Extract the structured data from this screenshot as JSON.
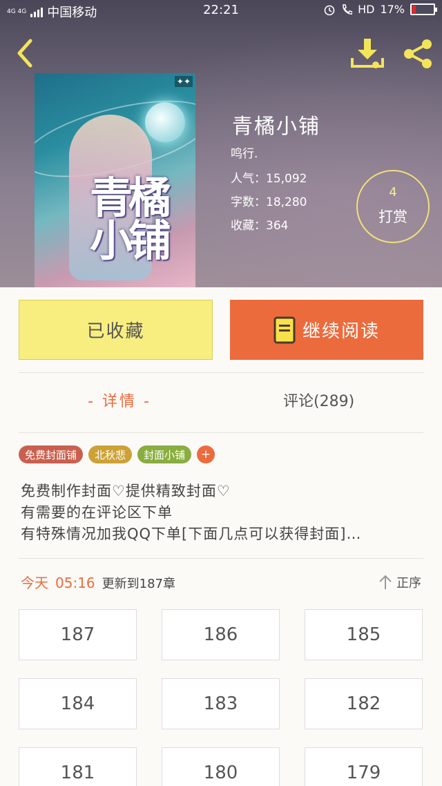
{
  "status_bar": {
    "network": "4G 4G",
    "carrier": "中国移动",
    "time": "22:21",
    "hd_label": "HD",
    "battery": "17%",
    "battery_level": 0.17
  },
  "header": {
    "back_icon": "chevron-left-icon",
    "download_icon": "download-icon",
    "share_icon": "share-icon"
  },
  "book": {
    "cover_title": "青橘小铺",
    "title": "青橘小铺",
    "author": "鸣行.",
    "popularity": "人气：15,092",
    "word_count": "字数：18,280",
    "favorites": "收藏：364"
  },
  "reward": {
    "count": "4",
    "label": "打赏"
  },
  "actions": {
    "favorited_label": "已收藏",
    "continue_label": "继续阅读"
  },
  "tabs": {
    "detail": "- 详情 -",
    "comments": "评论(289)"
  },
  "tags": [
    {
      "label": "免费封面铺",
      "color": "#c9604f"
    },
    {
      "label": "北秋悲",
      "color": "#cda235"
    },
    {
      "label": "封面小铺",
      "color": "#8aad3f"
    },
    {
      "label": "+",
      "color": "#ec6b3c"
    }
  ],
  "intro": {
    "line1": "免费制作封面♡提供精致封面♡",
    "line2": "有需要的在评论区下单",
    "line3": "有特殊情况加我QQ下单[下面几点可以获得封面]…"
  },
  "update": {
    "today": "今天",
    "time": "05:16",
    "chapter_text": "更新到187章",
    "sort_label": "正序"
  },
  "chapters": [
    "187",
    "186",
    "185",
    "184",
    "183",
    "182",
    "181",
    "180",
    "179"
  ],
  "colors": {
    "accent": "#ec6b3c",
    "favorite_bg": "#f8ee80",
    "reward_ring": "#f2e07a"
  }
}
